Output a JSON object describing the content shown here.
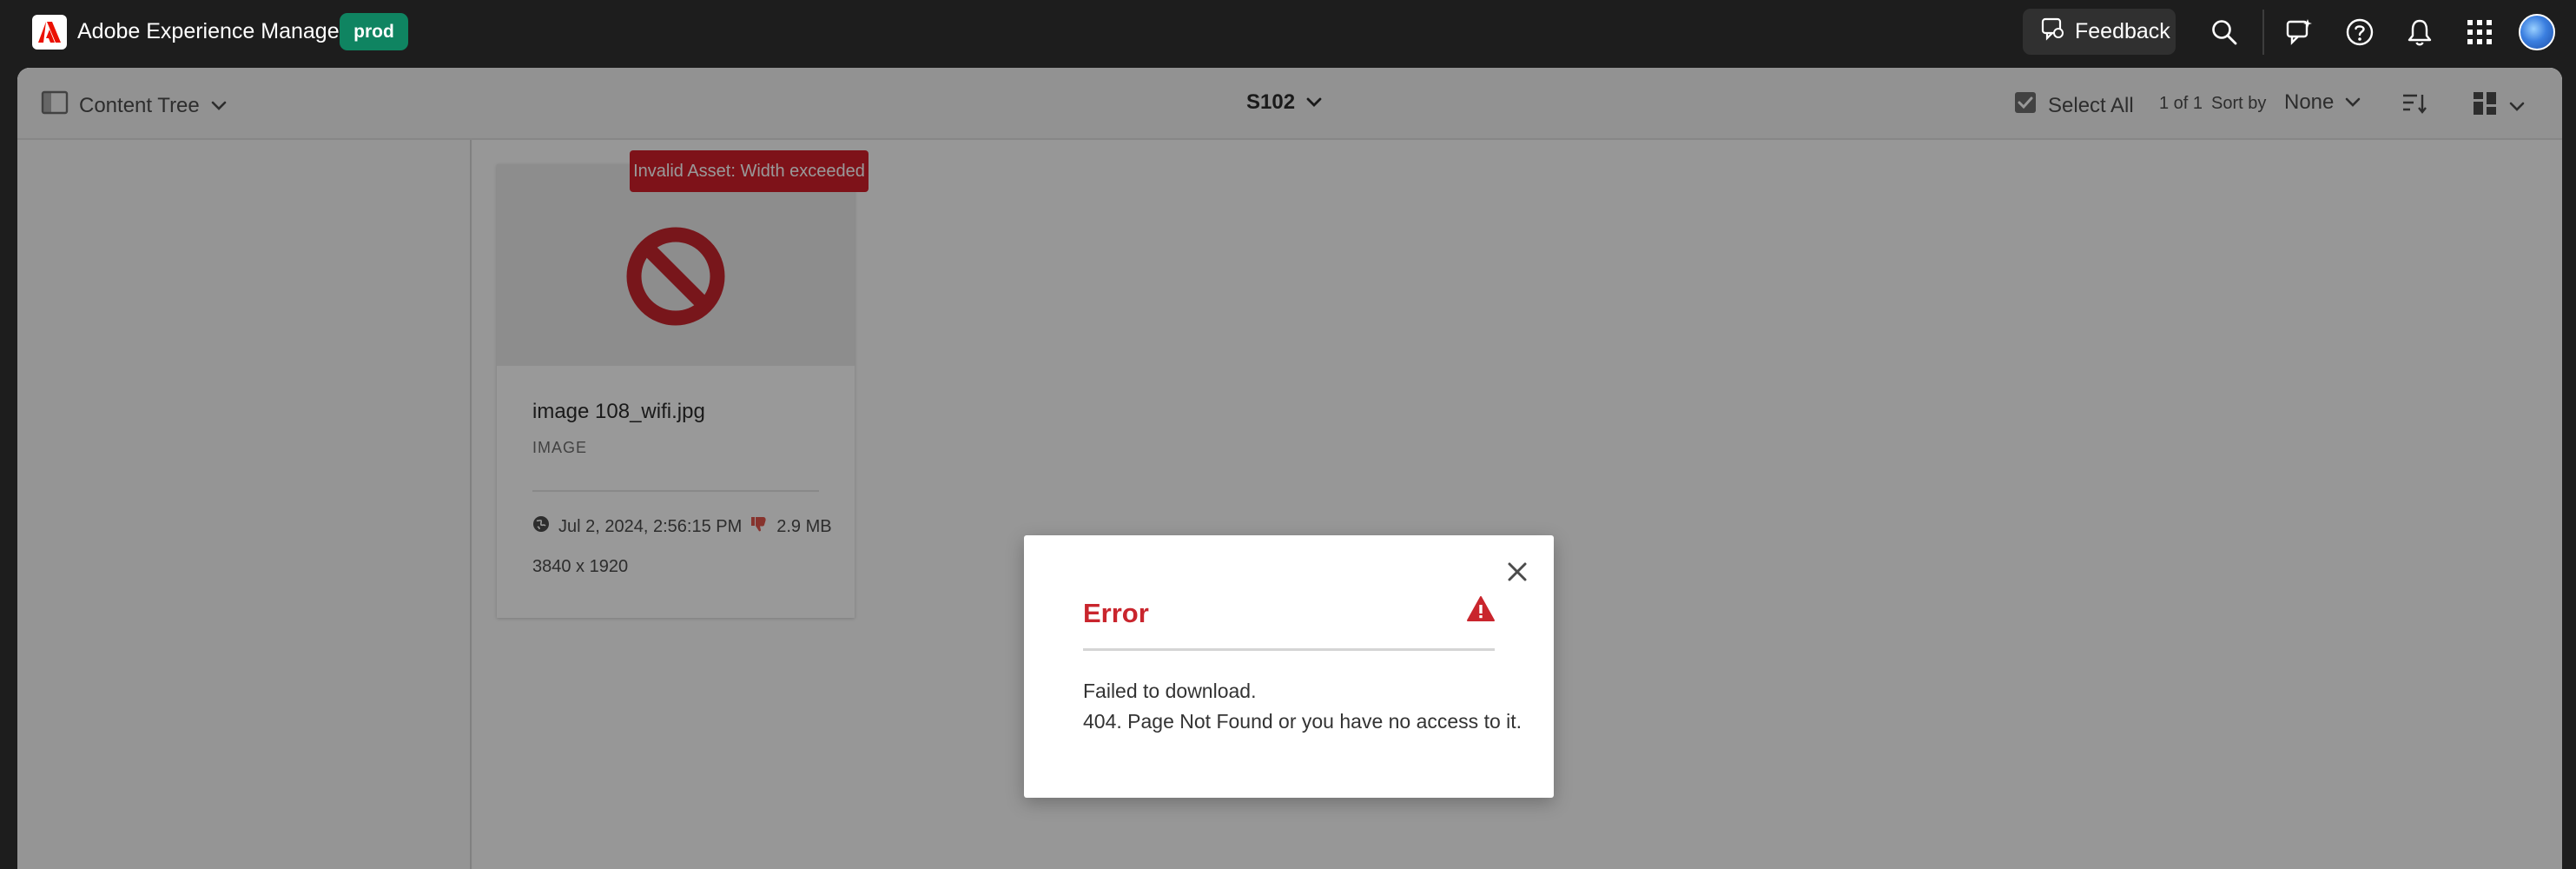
{
  "shell": {
    "app_title": "Adobe Experience Manager",
    "env_badge": "prod",
    "feedback_label": "Feedback"
  },
  "actionbar": {
    "rail_label": "Content Tree",
    "folder_title": "S102",
    "select_all_label": "Select All",
    "page_count": "1 of 1",
    "sort_by_label": "Sort by",
    "sort_value": "None"
  },
  "asset": {
    "name": "image 108_wifi.jpg",
    "type": "IMAGE",
    "modified": "Jul 2, 2024, 2:56:15 PM",
    "size": "2.9 MB",
    "dimensions": "3840 x 1920",
    "invalid_tag": "Invalid Asset: Width exceeded"
  },
  "dialog": {
    "title": "Error",
    "message_line1": "Failed to download.",
    "message_line2": "404. Page Not Found or you have no access to it."
  },
  "colors": {
    "shell_bg": "#1d1d1d",
    "env_badge": "#0f8461",
    "error_red": "#c9252d",
    "invalid_tag": "#d31f2b"
  },
  "icons": [
    "adobe-logo-icon",
    "feedback-icon",
    "search-icon",
    "whats-new-icon",
    "help-icon",
    "bell-icon",
    "app-switcher-icon",
    "rail-toggle-icon",
    "chevron-down-icon",
    "select-all-icon",
    "sort-order-icon",
    "view-switcher-icon",
    "blocked-icon",
    "globe-icon",
    "thumbs-down-icon",
    "close-icon",
    "warning-icon"
  ]
}
